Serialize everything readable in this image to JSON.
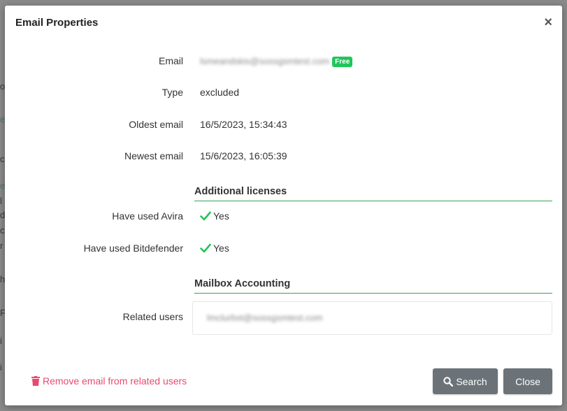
{
  "modal": {
    "title": "Email Properties",
    "close_symbol": "×"
  },
  "background_fragments": [
    "o",
    "e",
    "c",
    "e",
    "l",
    "d",
    "c",
    "r",
    "h",
    "F",
    "i",
    "i"
  ],
  "fields": {
    "email": {
      "label": "Email",
      "value": "lsmeandskis@sossgsmtest.com",
      "badge": "Free"
    },
    "type": {
      "label": "Type",
      "value": "excluded"
    },
    "oldest": {
      "label": "Oldest email",
      "value": "16/5/2023, 15:34:43"
    },
    "newest": {
      "label": "Newest email",
      "value": "15/6/2023, 16:05:39"
    }
  },
  "additional_licenses": {
    "title": "Additional licenses",
    "avira": {
      "label": "Have used Avira",
      "value": "Yes"
    },
    "bitdefender": {
      "label": "Have used Bitdefender",
      "value": "Yes"
    }
  },
  "mailbox_accounting": {
    "title": "Mailbox Accounting",
    "related_users": {
      "label": "Related users",
      "value": "lmclurbst@sossgsmtest.com"
    }
  },
  "footer": {
    "remove_label": "Remove email from related users",
    "search_label": "Search",
    "close_label": "Close"
  },
  "colors": {
    "accent_green": "#1fc65a",
    "section_rule": "#3aa357",
    "danger": "#e84a6f",
    "button": "#6b7378"
  },
  "icons": {
    "close": "close-icon",
    "check": "check-icon",
    "trash": "trash-icon",
    "search": "search-icon"
  }
}
